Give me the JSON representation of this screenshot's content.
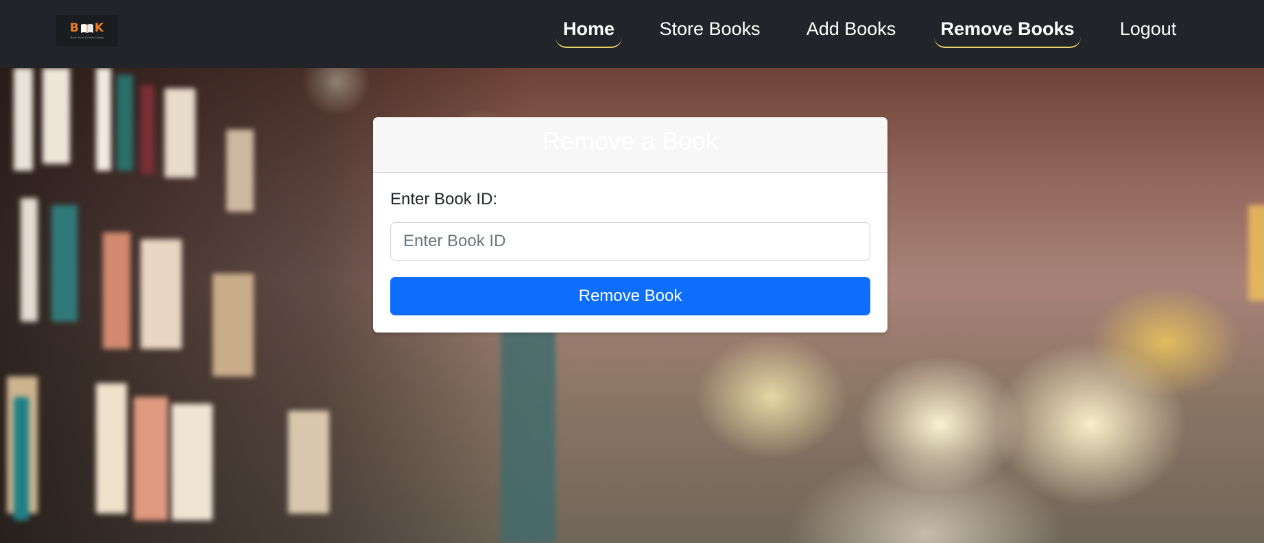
{
  "brand": {
    "logo_text": "BOOK",
    "logo_tagline": "Book Store & Public Library",
    "accent_color": "#f07c1f"
  },
  "nav": {
    "items": [
      {
        "label": "Home",
        "bold": true,
        "underlined": true
      },
      {
        "label": "Store Books",
        "bold": false,
        "underlined": false
      },
      {
        "label": "Add Books",
        "bold": false,
        "underlined": false
      },
      {
        "label": "Remove Books",
        "bold": true,
        "underlined": true
      },
      {
        "label": "Logout",
        "bold": false,
        "underlined": false
      }
    ],
    "background_color": "#212529",
    "underline_color": "#e8d36a"
  },
  "form": {
    "title": "Remove a Book",
    "field_label": "Enter Book ID:",
    "field_placeholder": "Enter Book ID",
    "field_value": "",
    "submit_label": "Remove Book",
    "submit_color": "#0d6efd"
  }
}
